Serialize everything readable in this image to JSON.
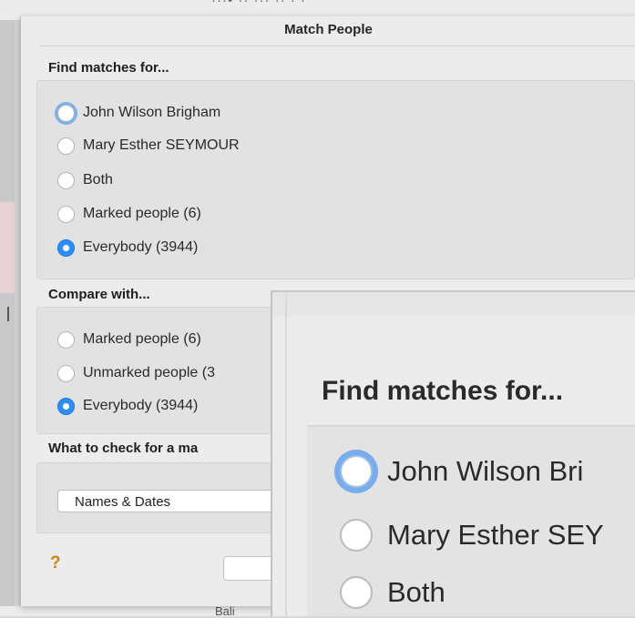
{
  "background_window": {
    "top_partial_text": "···• ·· ··· ·· · ·",
    "bottom_partial_text": "Bali"
  },
  "dialog": {
    "title": "Match People",
    "find_matches": {
      "heading": "Find matches for...",
      "options": [
        {
          "label": "John Wilson Brigham",
          "selected": false,
          "focused": true
        },
        {
          "label": "Mary Esther SEYMOUR",
          "selected": false,
          "focused": false
        },
        {
          "label": "Both",
          "selected": false,
          "focused": false
        },
        {
          "label": "Marked people (6)",
          "selected": false,
          "focused": false
        },
        {
          "label": "Everybody (3944)",
          "selected": true,
          "focused": false
        }
      ]
    },
    "compare_with": {
      "heading": "Compare with...",
      "options": [
        {
          "label": "Marked people (6)",
          "selected": false
        },
        {
          "label": "Unmarked people (3",
          "selected": false
        },
        {
          "label": "Everybody (3944)",
          "selected": true
        }
      ]
    },
    "check": {
      "heading": "What to check for a ma",
      "popup_value": "Names & Dates"
    },
    "help_label": "?",
    "button_label": ""
  },
  "zoom_inset": {
    "heading": "Find matches for...",
    "options": [
      {
        "label": "John Wilson Bri"
      },
      {
        "label": "Mary Esther SEY"
      },
      {
        "label": "Both"
      }
    ]
  },
  "colors": {
    "accent_blue": "#2e8ef5",
    "focus_ring": "#7eb0ea",
    "help_orange": "#c98516",
    "sheet_bg": "#ececec"
  }
}
